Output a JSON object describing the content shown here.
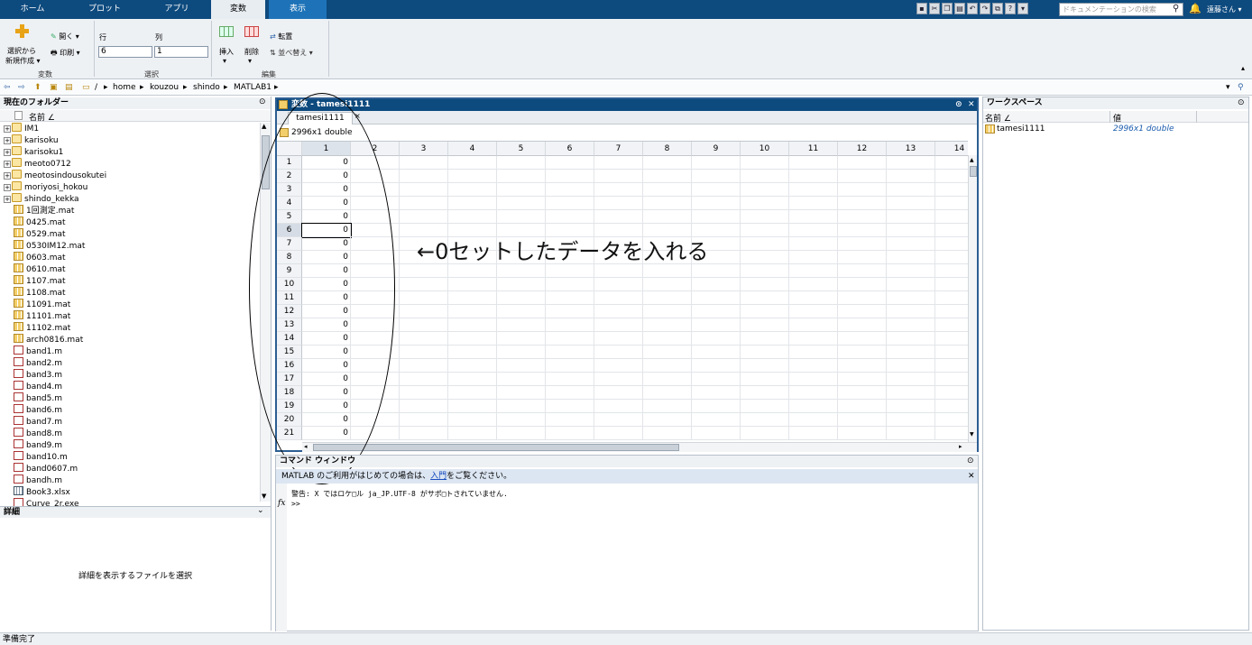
{
  "ribbon_tabs": [
    "ホーム",
    "プロット",
    "アプリ",
    "変数",
    "表示"
  ],
  "search": {
    "placeholder": "ドキュメンテーションの検索"
  },
  "user": {
    "name": "遠藤さん"
  },
  "toolbar": {
    "new_from_selection_1": "選択から",
    "new_from_selection_2": "新規作成",
    "open": "開く",
    "print": "印刷",
    "row_label": "行",
    "col_label": "列",
    "row_value": "6",
    "col_value": "1",
    "insert": "挿入",
    "delete": "削除",
    "transpose": "転置",
    "sort": "並べ替え",
    "group_variable": "変数",
    "group_selection": "選択",
    "group_edit": "編集"
  },
  "address": {
    "root": "/",
    "crumbs": [
      "home",
      "kouzou",
      "shindo",
      "MATLAB1"
    ]
  },
  "folder_panel": {
    "title": "現在のフォルダー",
    "name_header": "名前",
    "items": [
      {
        "name": "IM1",
        "type": "folder"
      },
      {
        "name": "karisoku",
        "type": "folder"
      },
      {
        "name": "karisoku1",
        "type": "folder"
      },
      {
        "name": "meoto0712",
        "type": "folder"
      },
      {
        "name": "meotosindousokutei",
        "type": "folder"
      },
      {
        "name": "moriyosi_hokou",
        "type": "folder"
      },
      {
        "name": "shindo_kekka",
        "type": "folder"
      },
      {
        "name": "1回測定.mat",
        "type": "mat"
      },
      {
        "name": "0425.mat",
        "type": "mat"
      },
      {
        "name": "0529.mat",
        "type": "mat"
      },
      {
        "name": "0530IM12.mat",
        "type": "mat"
      },
      {
        "name": "0603.mat",
        "type": "mat"
      },
      {
        "name": "0610.mat",
        "type": "mat"
      },
      {
        "name": "1107.mat",
        "type": "mat"
      },
      {
        "name": "1108.mat",
        "type": "mat"
      },
      {
        "name": "11091.mat",
        "type": "mat"
      },
      {
        "name": "11101.mat",
        "type": "mat"
      },
      {
        "name": "11102.mat",
        "type": "mat"
      },
      {
        "name": "arch0816.mat",
        "type": "mat"
      },
      {
        "name": "band1.m",
        "type": "m"
      },
      {
        "name": "band2.m",
        "type": "m"
      },
      {
        "name": "band3.m",
        "type": "m"
      },
      {
        "name": "band4.m",
        "type": "m"
      },
      {
        "name": "band5.m",
        "type": "m"
      },
      {
        "name": "band6.m",
        "type": "m"
      },
      {
        "name": "band7.m",
        "type": "m"
      },
      {
        "name": "band8.m",
        "type": "m"
      },
      {
        "name": "band9.m",
        "type": "m"
      },
      {
        "name": "band10.m",
        "type": "m"
      },
      {
        "name": "band0607.m",
        "type": "m"
      },
      {
        "name": "bandh.m",
        "type": "m"
      },
      {
        "name": "Book3.xlsx",
        "type": "xls"
      },
      {
        "name": "Curve_2r.exe",
        "type": "file"
      }
    ],
    "details_title": "詳細",
    "details_message": "詳細を表示するファイルを選択"
  },
  "variable_editor": {
    "title": "変数 - tamesi1111",
    "tab": "tamesi1111",
    "info": "2996x1 double",
    "columns": [
      "1",
      "2",
      "3",
      "4",
      "5",
      "6",
      "7",
      "8",
      "9",
      "10",
      "11",
      "12",
      "13",
      "14"
    ],
    "rows": [
      "1",
      "2",
      "3",
      "4",
      "5",
      "6",
      "7",
      "8",
      "9",
      "10",
      "11",
      "12",
      "13",
      "14",
      "15",
      "16",
      "17",
      "18",
      "19",
      "20",
      "21"
    ],
    "col1_values": [
      "0",
      "0",
      "0",
      "0",
      "0",
      "0",
      "0",
      "0",
      "0",
      "0",
      "0",
      "0",
      "0",
      "0",
      "0",
      "0",
      "0",
      "0",
      "0",
      "0",
      "0"
    ],
    "selected_row": 6
  },
  "annotation": "←0セットしたデータを入れる",
  "command_window": {
    "title": "コマンド ウィンドウ",
    "banner_prefix": "MATLAB のご利用がはじめての場合は、",
    "banner_link": "入門",
    "banner_suffix": "をご覧ください。",
    "warning": "警告: X ではロケ□ル ja_JP.UTF-8 がサポ□トされていません.",
    "prompt": ">>",
    "fx": "fx"
  },
  "workspace": {
    "title": "ワークスペース",
    "name_header": "名前",
    "value_header": "値",
    "items": [
      {
        "name": "tamesi1111",
        "value": "2996x1 double"
      }
    ]
  },
  "status": "準備完了"
}
